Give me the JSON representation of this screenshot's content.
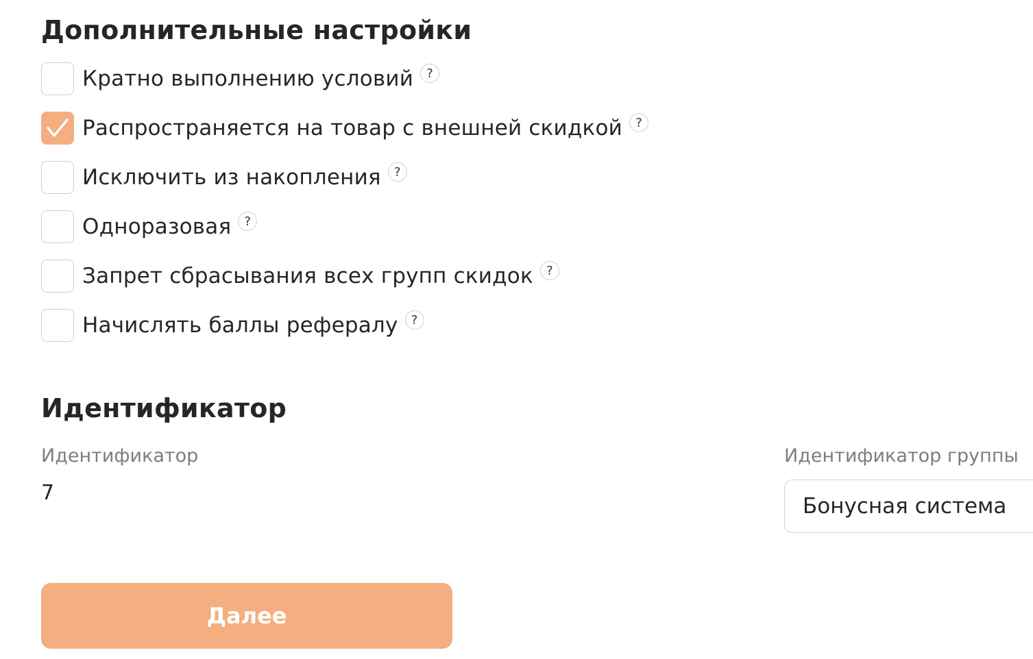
{
  "extra_settings": {
    "title": "Дополнительные настройки",
    "options": [
      {
        "label": "Кратно выполнению условий",
        "checked": false,
        "help": "?"
      },
      {
        "label": "Распространяется на товар с внешней скидкой",
        "checked": true,
        "help": "?"
      },
      {
        "label": "Исключить из накопления",
        "checked": false,
        "help": "?"
      },
      {
        "label": "Одноразовая",
        "checked": false,
        "help": "?"
      },
      {
        "label": "Запрет сбрасывания всех групп скидок",
        "checked": false,
        "help": "?"
      },
      {
        "label": "Начислять баллы рефералу",
        "checked": false,
        "help": "?"
      }
    ]
  },
  "identifier_section": {
    "title": "Идентификатор",
    "identifier_label": "Идентификатор",
    "identifier_value": "7",
    "group_label": "Идентификатор группы",
    "group_value": "Бонусная система"
  },
  "actions": {
    "next_label": "Далее"
  },
  "colors": {
    "accent": "#f4ae80",
    "text": "#262626",
    "muted": "#7d7d7d",
    "border": "#cfcfcf"
  },
  "icons": {
    "checkmark": "check-icon",
    "help": "question-circle-icon"
  }
}
